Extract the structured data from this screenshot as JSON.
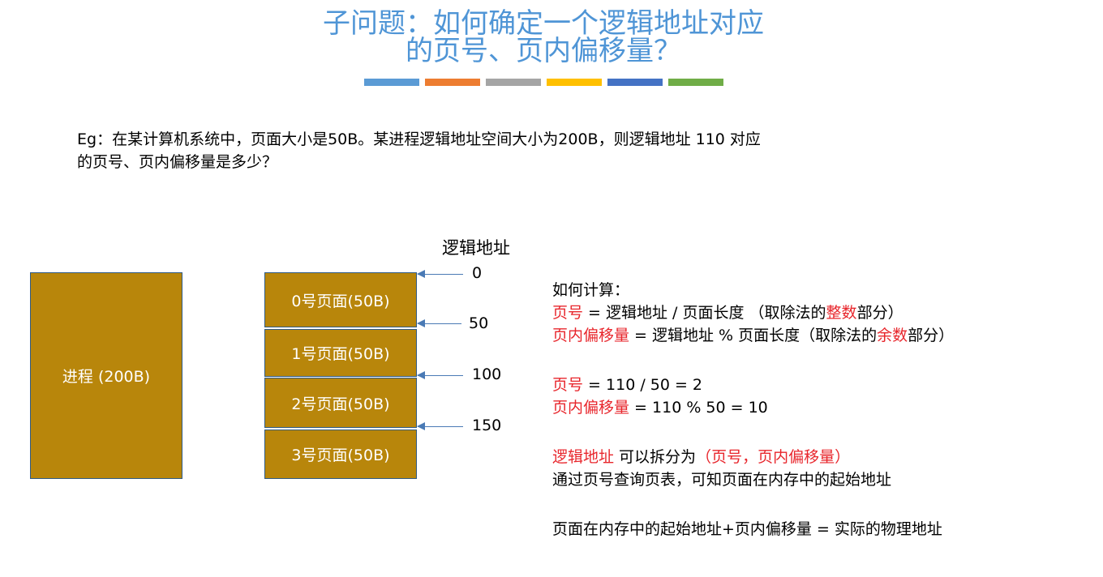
{
  "title": {
    "line1": "子问题：如何确定一个逻辑地址对应",
    "line2": "的页号、页内偏移量？"
  },
  "colorbar": [
    "#5b9bd5",
    "#ed7d31",
    "#a5a5a5",
    "#ffc000",
    "#4472c4",
    "#70ad47"
  ],
  "question": {
    "line1": "Eg：在某计算机系统中，页面大小是50B。某进程逻辑地址空间大小为200B，则逻辑地址 110 对应",
    "line2": "的页号、页内偏移量是多少？"
  },
  "process_box": "进程 (200B)",
  "pages": [
    "0号页面(50B)",
    "1号页面(50B)",
    "2号页面(50B)",
    "3号页面(50B)"
  ],
  "address_axis": {
    "title": "逻辑地址",
    "ticks": [
      "0",
      "50",
      "100",
      "150"
    ]
  },
  "explanation": {
    "heading": "如何计算：",
    "f1_red": "页号",
    "f1_rest": " = 逻辑地址 / 页面长度 （取除法的",
    "f1_red2": "整数",
    "f1_tail": "部分）",
    "f2_red": "页内偏移量",
    "f2_rest": " = 逻辑地址 % 页面长度（取除法的",
    "f2_red2": "余数",
    "f2_tail": "部分）",
    "c1_red": "页号",
    "c1_rest": " = 110 / 50 = 2",
    "c2_red": "页内偏移量",
    "c2_rest": " = 110 % 50 = 10",
    "s1_red": "逻辑地址",
    "s1_rest": " 可以拆分为",
    "s1_red2": "（页号，页内偏移量）",
    "s2": "通过页号查询页表，可知页面在内存中的起始地址",
    "s3": "页面在内存中的起始地址+页内偏移量 = 实际的物理地址"
  },
  "colors": {
    "title": "#4f95d6",
    "box_fill": "#b8860b",
    "highlight": "#e8262c",
    "arrow": "#4a7ab5"
  }
}
